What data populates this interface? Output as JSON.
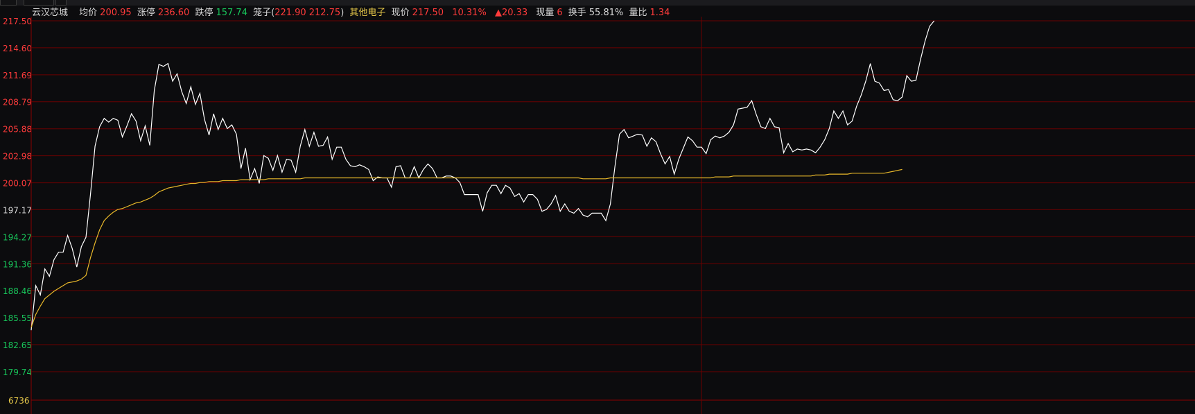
{
  "window": {
    "tabs": [
      "",
      ""
    ]
  },
  "header": {
    "stock_name": "云汉芯城",
    "avg_label": "均价",
    "avg_value": "200.95",
    "limit_up_label": "涨停",
    "limit_up_value": "236.60",
    "limit_down_label": "跌停",
    "limit_down_value": "157.74",
    "range_label": "笼子(",
    "range_low": "221.90",
    "range_high": "212.75",
    "range_close": ")",
    "sector": "其他电子",
    "price_label": "现价",
    "price_value": "217.50",
    "change_pct": "10.31%",
    "change_value": "▲20.33",
    "volume_label": "现量",
    "volume_value": "6",
    "turnover_label": "换手",
    "turnover_value": "55.81%",
    "vol_ratio_label": "量比",
    "vol_ratio_value": "1.34"
  },
  "colors": {
    "background": "#0c0c0e",
    "grid": "#6b0000",
    "price_line": "#ffffff",
    "avg_line": "#e8b82a",
    "up": "#ff3b3b",
    "down": "#18c55a",
    "neutral": "#d8d8d8",
    "volume_label": "#e6c84a"
  },
  "chart_data": {
    "type": "line",
    "title": "",
    "xlabel": "",
    "ylabel": "",
    "ylim": [
      179.74,
      217.5
    ],
    "y_ticks": [
      {
        "value": 217.5,
        "label": "217.50",
        "color": "up"
      },
      {
        "value": 214.6,
        "label": "214.60",
        "color": "up"
      },
      {
        "value": 211.69,
        "label": "211.69",
        "color": "up"
      },
      {
        "value": 208.79,
        "label": "208.79",
        "color": "up"
      },
      {
        "value": 205.88,
        "label": "205.88",
        "color": "up"
      },
      {
        "value": 202.98,
        "label": "202.98",
        "color": "up"
      },
      {
        "value": 200.07,
        "label": "200.07",
        "color": "up"
      },
      {
        "value": 197.17,
        "label": "197.17",
        "color": "neutral"
      },
      {
        "value": 194.27,
        "label": "194.27",
        "color": "down"
      },
      {
        "value": 191.36,
        "label": "191.36",
        "color": "down"
      },
      {
        "value": 188.46,
        "label": "188.46",
        "color": "down"
      },
      {
        "value": 185.55,
        "label": "185.55",
        "color": "down"
      },
      {
        "value": 182.65,
        "label": "182.65",
        "color": "down"
      },
      {
        "value": 179.74,
        "label": "179.74",
        "color": "down"
      }
    ],
    "volume_label": "6736",
    "total_points": 241,
    "series": [
      {
        "key": "price",
        "values": [
          184.2,
          189.0,
          188.0,
          190.8,
          190.0,
          191.8,
          192.6,
          192.6,
          194.4,
          193.0,
          191.0,
          193.2,
          194.2,
          198.8,
          204.0,
          206.1,
          207.0,
          206.6,
          207.0,
          206.8,
          205.0,
          206.2,
          207.5,
          206.7,
          204.6,
          206.2,
          204.1,
          210.0,
          212.8,
          212.6,
          212.9,
          211.0,
          211.8,
          209.9,
          208.6,
          210.4,
          208.5,
          209.7,
          206.9,
          205.2,
          207.5,
          205.8,
          207.0,
          205.9,
          206.3,
          205.3,
          201.6,
          203.8,
          200.4,
          201.6,
          200.0,
          203.0,
          202.7,
          201.4,
          203.0,
          201.2,
          202.6,
          202.5,
          201.2,
          204.0,
          205.8,
          204.0,
          205.5,
          204.0,
          204.1,
          205.0,
          202.6,
          203.9,
          203.9,
          202.6,
          201.9,
          201.8,
          202.0,
          201.8,
          201.5,
          200.3,
          200.7,
          200.6,
          200.6,
          199.6,
          201.8,
          201.9,
          200.6,
          200.6,
          201.8,
          200.6,
          201.5,
          202.1,
          201.6,
          200.6,
          200.6,
          200.8,
          200.8,
          200.6,
          200.1,
          198.8,
          198.8,
          198.8,
          198.8,
          197.0,
          199.0,
          199.8,
          199.8,
          198.9,
          199.8,
          199.5,
          198.6,
          198.9,
          198.0,
          198.8,
          198.8,
          198.3,
          197.0,
          197.2,
          197.8,
          198.7,
          197.0,
          197.8,
          197.0,
          196.8,
          197.3,
          196.6,
          196.4,
          196.8,
          196.8,
          196.8,
          196.0,
          197.8,
          201.8,
          205.3,
          205.8,
          204.9,
          205.1,
          205.3,
          205.2,
          204.0,
          204.9,
          204.5,
          203.2,
          202.1,
          202.9,
          201.0,
          202.6,
          203.8,
          205.0,
          204.6,
          203.9,
          203.9,
          203.2,
          204.7,
          205.1,
          204.9,
          205.1,
          205.5,
          206.3,
          208.0,
          208.1,
          208.2,
          208.9,
          207.4,
          206.1,
          205.9,
          207.0,
          206.1,
          206.0,
          203.3,
          204.3,
          203.4,
          203.7,
          203.6,
          203.7,
          203.6,
          203.3,
          203.9,
          204.7,
          205.9,
          207.8,
          207.0,
          207.8,
          206.3,
          206.7,
          208.3,
          209.5,
          211.0,
          212.9,
          211.0,
          210.8,
          210.0,
          210.1,
          209.0,
          208.9,
          209.3,
          211.6,
          211.0,
          211.1,
          213.3,
          215.3,
          216.9,
          217.5
        ],
        "note": ""
      },
      {
        "key": "avg",
        "values": [
          184.5,
          185.9,
          186.8,
          187.6,
          188.0,
          188.4,
          188.7,
          189.0,
          189.3,
          189.4,
          189.5,
          189.7,
          190.1,
          192.0,
          193.6,
          195.0,
          196.0,
          196.5,
          196.9,
          197.2,
          197.3,
          197.5,
          197.7,
          197.9,
          198.0,
          198.2,
          198.4,
          198.7,
          199.1,
          199.3,
          199.5,
          199.6,
          199.7,
          199.8,
          199.9,
          200.0,
          200.0,
          200.1,
          200.1,
          200.2,
          200.2,
          200.2,
          200.3,
          200.3,
          200.3,
          200.3,
          200.4,
          200.4,
          200.4,
          200.4,
          200.4,
          200.4,
          200.5,
          200.5,
          200.5,
          200.5,
          200.5,
          200.5,
          200.5,
          200.5,
          200.6,
          200.6,
          200.6,
          200.6,
          200.6,
          200.6,
          200.6,
          200.6,
          200.6,
          200.6,
          200.6,
          200.6,
          200.6,
          200.6,
          200.6,
          200.6,
          200.6,
          200.6,
          200.6,
          200.6,
          200.6,
          200.6,
          200.6,
          200.6,
          200.6,
          200.6,
          200.6,
          200.6,
          200.6,
          200.6,
          200.6,
          200.6,
          200.6,
          200.6,
          200.6,
          200.6,
          200.6,
          200.6,
          200.6,
          200.6,
          200.6,
          200.6,
          200.6,
          200.6,
          200.6,
          200.6,
          200.6,
          200.6,
          200.6,
          200.6,
          200.6,
          200.6,
          200.6,
          200.6,
          200.6,
          200.6,
          200.6,
          200.6,
          200.6,
          200.6,
          200.6,
          200.5,
          200.5,
          200.5,
          200.5,
          200.5,
          200.5,
          200.6,
          200.6,
          200.6,
          200.6,
          200.6,
          200.6,
          200.6,
          200.6,
          200.6,
          200.6,
          200.6,
          200.6,
          200.6,
          200.6,
          200.6,
          200.6,
          200.6,
          200.6,
          200.6,
          200.6,
          200.6,
          200.6,
          200.6,
          200.7,
          200.7,
          200.7,
          200.7,
          200.8,
          200.8,
          200.8,
          200.8,
          200.8,
          200.8,
          200.8,
          200.8,
          200.8,
          200.8,
          200.8,
          200.8,
          200.8,
          200.8,
          200.8,
          200.8,
          200.8,
          200.8,
          200.9,
          200.9,
          200.9,
          201.0,
          201.0,
          201.0,
          201.0,
          201.0,
          201.1,
          201.1,
          201.1,
          201.1,
          201.1,
          201.1,
          201.1,
          201.1,
          201.2,
          201.3,
          201.4,
          201.5
        ],
        "note": ""
      }
    ]
  }
}
